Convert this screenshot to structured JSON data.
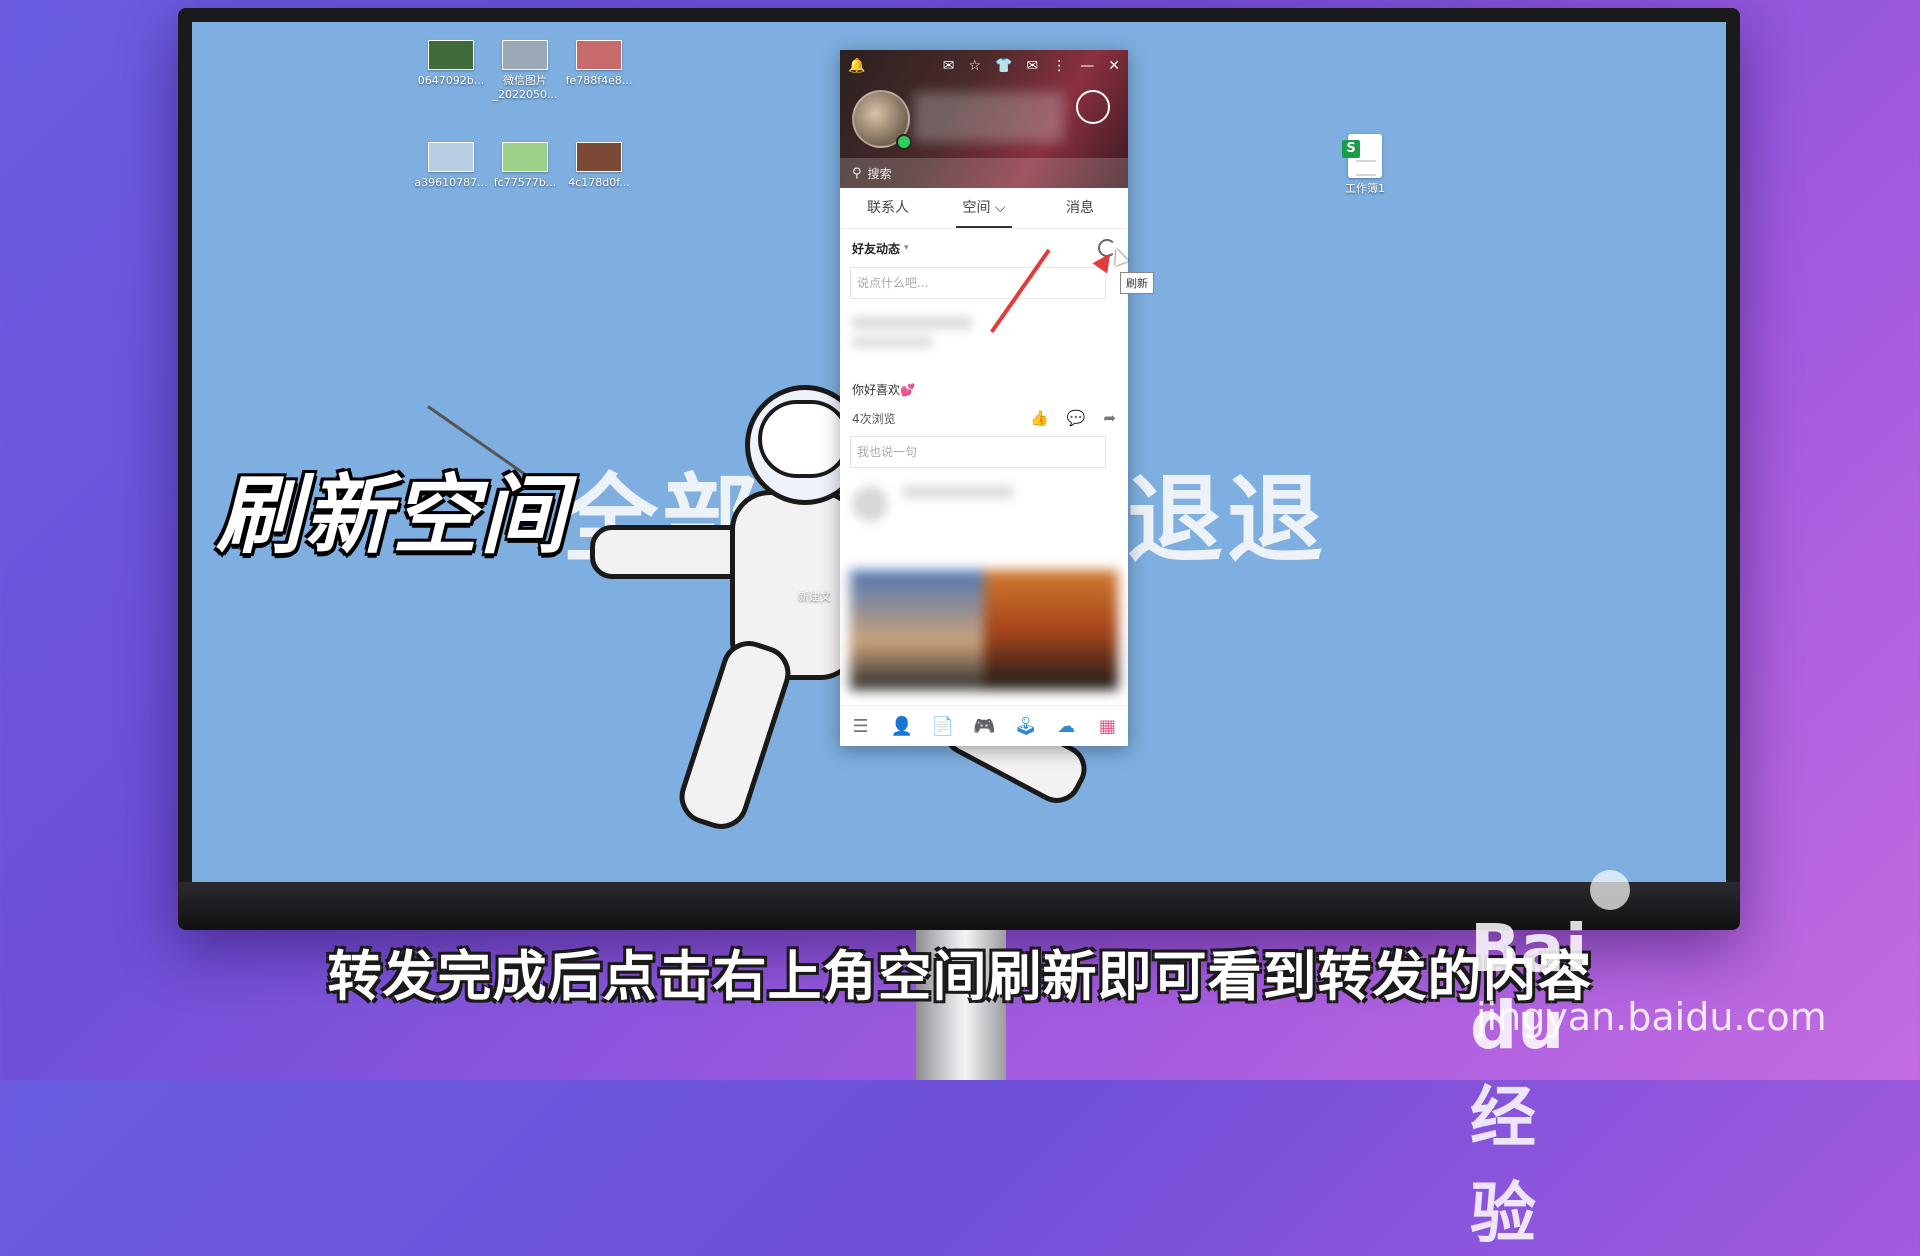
{
  "desktop_icons": [
    {
      "label": "0647092b...",
      "color": "#3f6a3a"
    },
    {
      "label": "微信图片_2022050...",
      "color": "#9aa7b4"
    },
    {
      "label": "fe788f4e8...",
      "color": "#c76a6a"
    },
    {
      "label": "a39610787...",
      "color": "#b7cde2"
    },
    {
      "label": "fc77577b...",
      "color": "#9ccf88"
    },
    {
      "label": "4c178d0f...",
      "color": "#7a4a36"
    }
  ],
  "sheet_icon": {
    "letter": "S",
    "label": "工作簿1"
  },
  "desk_file_label": "新建文",
  "wallpaper": {
    "left_word": "全部",
    "right_word": "退退"
  },
  "overlay_title": "刷新空间",
  "qq": {
    "search_placeholder": "搜索",
    "tabs": [
      "联系人",
      "空间 ⌵",
      "消息"
    ],
    "feed_title": "好友动态",
    "feed_caret": "▾",
    "say_placeholder": "说点什么吧...",
    "tooltip": "刷新",
    "post_text": "你好喜欢💕",
    "views": "4次浏览",
    "comment_placeholder": "我也说一句"
  },
  "subtitle": "转发完成后点击右上角空间刷新即可看到转发的内容",
  "watermark": {
    "brand": "Bai du 经验",
    "url": "jingyan.baidu.com"
  }
}
